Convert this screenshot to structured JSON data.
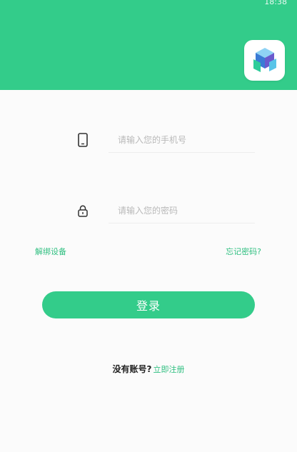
{
  "status_bar": {
    "time": "18:38"
  },
  "colors": {
    "brand_green": "#33cc8a",
    "link_green": "#2fbf80",
    "background": "#fbfbfb"
  },
  "icons": {
    "logo": "app-logo-cube",
    "phone": "phone-icon",
    "password": "lock-icon"
  },
  "form": {
    "phone_placeholder": "请输入您的手机号",
    "phone_value": "",
    "password_placeholder": "请输入您的密码",
    "password_value": ""
  },
  "links": {
    "unbind_device": "解绑设备",
    "forgot_password": "忘记密码?"
  },
  "login_button": "登录",
  "register": {
    "prompt": "没有账号?",
    "link": "立即注册"
  }
}
